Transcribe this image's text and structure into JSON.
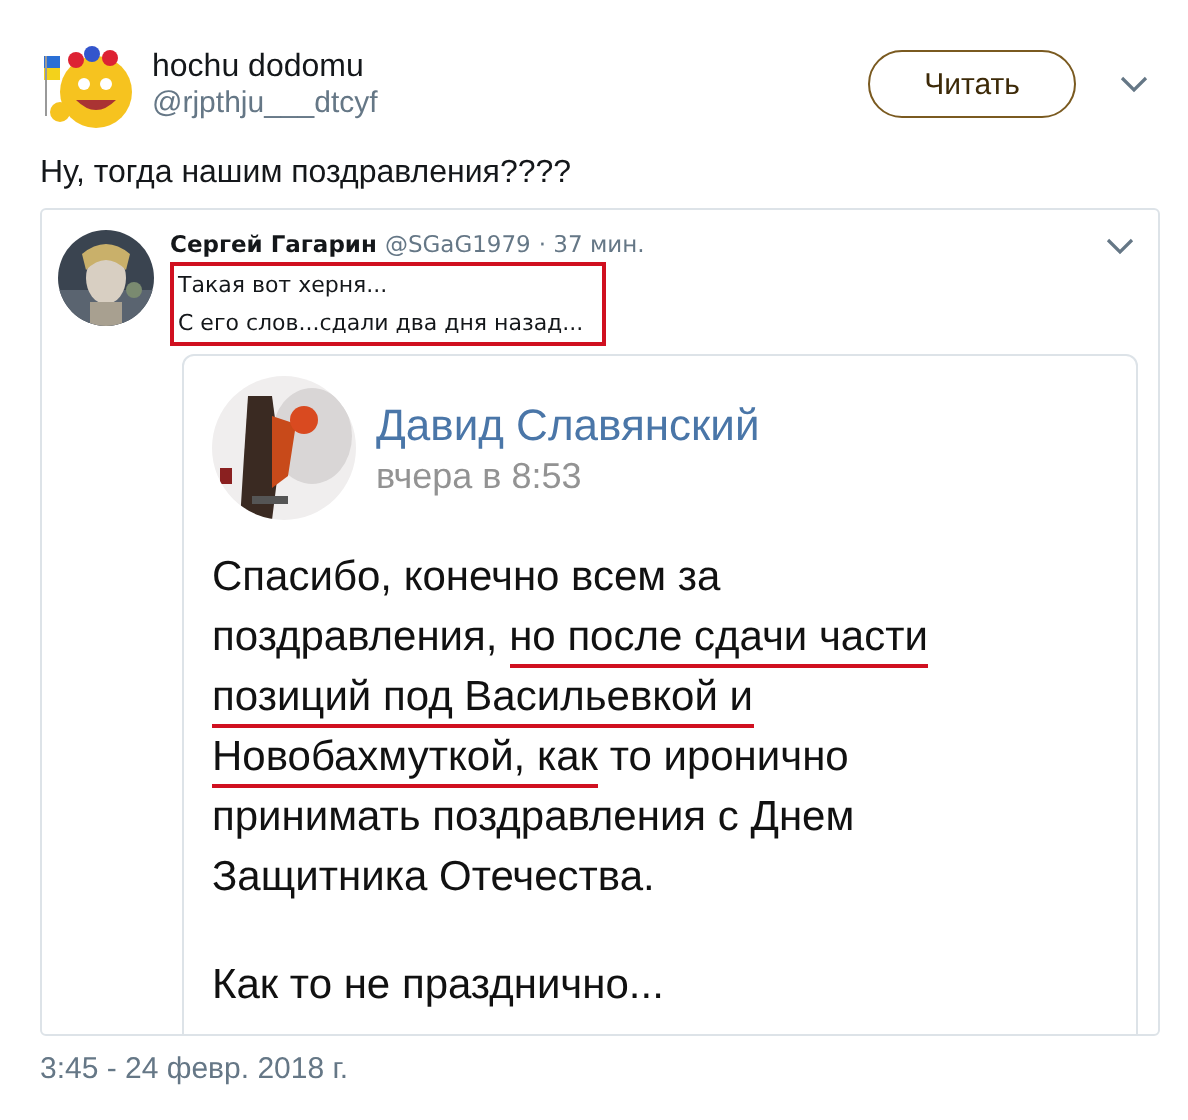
{
  "author": {
    "name": "hochu dodomu",
    "handle": "@rjpthju___dtcyf"
  },
  "follow_button": {
    "label": "Читать"
  },
  "tweet_text": "Ну, тогда нашим поздравления????",
  "embedded_screenshot": {
    "quoted_tweet": {
      "name": "Сергей Гагарин",
      "handle": "@SGaG1979",
      "time": "· 37 мин.",
      "highlighted": true,
      "lines": [
        "Такая вот херня...",
        "С его слов...сдали два дня назад..."
      ]
    },
    "vk_post": {
      "name": "Давид Славянский",
      "time": "вчера в 8:53",
      "paragraphs": [
        {
          "lines": [
            [
              {
                "text": "Спасибо, конечно всем за",
                "underlined": false
              }
            ],
            [
              {
                "text": "поздравления, ",
                "underlined": false
              },
              {
                "text": "но после сдачи части",
                "underlined": true
              }
            ],
            [
              {
                "text": "позиций под Васильевкой и",
                "underlined": true
              }
            ],
            [
              {
                "text": "Новобахмуткой, как",
                "underlined": true
              },
              {
                "text": " то иронично",
                "underlined": false
              }
            ],
            [
              {
                "text": "принимать поздравления с Днем",
                "underlined": false
              }
            ],
            [
              {
                "text": "Защитника Отечества.",
                "underlined": false
              }
            ]
          ]
        },
        {
          "lines": [
            [
              {
                "text": "Как то не празднично...",
                "underlined": false
              }
            ]
          ]
        }
      ]
    }
  },
  "timestamp": "3:45 - 24 февр. 2018 г."
}
